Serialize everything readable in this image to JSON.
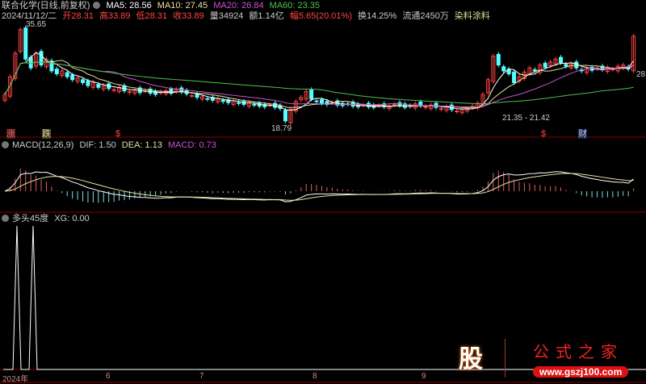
{
  "header": {
    "stock": "联合化学(日线,前复权)",
    "ma5": "MA5: 28.56",
    "ma10": "MA10: 27.45",
    "ma20": "MA20: 26.84",
    "ma60": "MA60: 23.35",
    "date": "2024/11/12/二",
    "open": "开28.31",
    "high": "高33.89",
    "low": "低28.31",
    "close": "收33.89",
    "vol": "量34924",
    "amount": "额1.14亿",
    "change": "幅5.65(20.01%)",
    "turnover": "换14.25%",
    "float": "流通2450万",
    "sector": "染料涂料"
  },
  "price_labels": {
    "high": "35.65",
    "low": "18.79",
    "range": "21.35 - 21.42",
    "last": "28."
  },
  "markers": [
    "涨",
    "跌",
    "$",
    "$",
    "财"
  ],
  "macd": {
    "title": "MACD(12,26,9)",
    "dif": "DIF: 1.50",
    "dea": "DEA: 1.13",
    "macd": "MACD: 0.73"
  },
  "xg": {
    "title": "多头45度",
    "value": "XG: 0.00"
  },
  "xaxis": [
    "2024年",
    "6",
    "7",
    "8",
    "9"
  ],
  "logo": {
    "glyph": "股",
    "name": "公式之家",
    "url": "www.gszj100.com"
  },
  "colors": {
    "up": "#ff4040",
    "down": "#54ffff",
    "ma5": "#ffffff",
    "ma10": "#e8e0a0",
    "ma20": "#d050d0",
    "ma60": "#50c050"
  },
  "chart_data": {
    "type": "candlestick",
    "closes": [
      24,
      27,
      31,
      35,
      30,
      28.5,
      31,
      29,
      30,
      28,
      27.5,
      28,
      27,
      26.5,
      26.8,
      26,
      25.5,
      26,
      25.2,
      25.5,
      25,
      24.8,
      25.2,
      24.6,
      24.5,
      24.8,
      24.3,
      24.6,
      24.2,
      24,
      24.4,
      24.6,
      24.2,
      24.8,
      24.4,
      24.1,
      23.8,
      23.5,
      23.6,
      23.2,
      23,
      23.3,
      22.8,
      22.6,
      22.9,
      22.5,
      22.3,
      22.6,
      22.2,
      22,
      21.9,
      22.2,
      21.8,
      21.6,
      19.5,
      21.5,
      22.8,
      23.5,
      24.5,
      23.2,
      22.8,
      22.5,
      22.3,
      22.6,
      22.2,
      22.1,
      22.4,
      22,
      21.9,
      22.2,
      21.9,
      21.8,
      22.1,
      21.9,
      22,
      22.3,
      22.1,
      21.8,
      22,
      22.4,
      22.1,
      21.9,
      22.2,
      21.8,
      21.6,
      21.9,
      21.4,
      21.2,
      21.5,
      21.6,
      22,
      22.5,
      24,
      26.5,
      30.5,
      29,
      28,
      27.5,
      26,
      27,
      27.8,
      28.5,
      28,
      29,
      28.6,
      29.5,
      30,
      29.4,
      28.8,
      29.2,
      28.5,
      28,
      28.3,
      28.1,
      28.5,
      28.2,
      28.6,
      28.3,
      28.8,
      29,
      28.31,
      33.89
    ]
  }
}
